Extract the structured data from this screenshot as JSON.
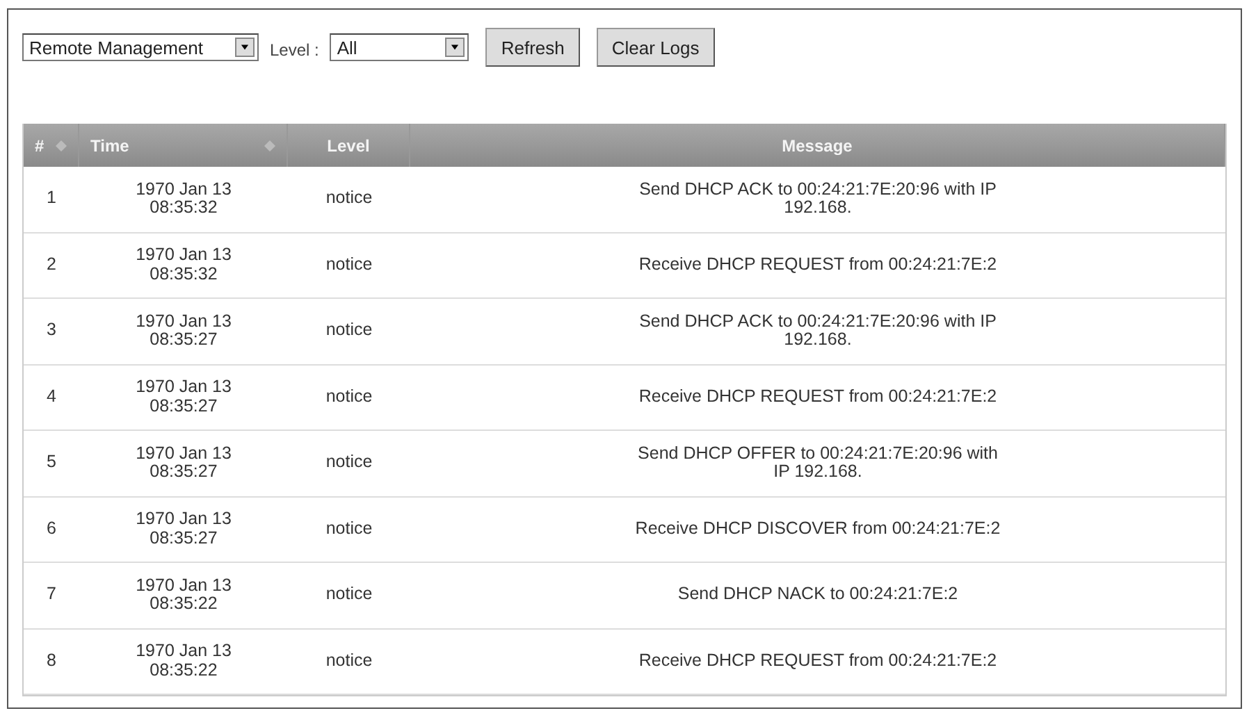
{
  "toolbar": {
    "category": {
      "value": "Remote Management"
    },
    "level_label": "Level :",
    "level": {
      "value": "All"
    },
    "buttons": [
      "Refresh",
      "Clear Logs"
    ]
  },
  "table": {
    "columns": [
      {
        "label": "#",
        "sortable": true
      },
      {
        "label": "Time",
        "sortable": true
      },
      {
        "label": "Level",
        "sortable": false
      },
      {
        "label": "Message",
        "sortable": false
      }
    ],
    "rows": [
      {
        "index": "1",
        "date": "1970 Jan 13",
        "time": "08:35:32",
        "level": "notice",
        "message": "Send DHCP ACK to 00:24:21:7E:20:96 with IP 192.168."
      },
      {
        "index": "2",
        "date": "1970 Jan 13",
        "time": "08:35:32",
        "level": "notice",
        "message": "Receive DHCP REQUEST from 00:24:21:7E:2"
      },
      {
        "index": "3",
        "date": "1970 Jan 13",
        "time": "08:35:27",
        "level": "notice",
        "message": "Send DHCP ACK to 00:24:21:7E:20:96 with IP 192.168."
      },
      {
        "index": "4",
        "date": "1970 Jan 13",
        "time": "08:35:27",
        "level": "notice",
        "message": "Receive DHCP REQUEST from 00:24:21:7E:2"
      },
      {
        "index": "5",
        "date": "1970 Jan 13",
        "time": "08:35:27",
        "level": "notice",
        "message": "Send DHCP OFFER to 00:24:21:7E:20:96 with IP 192.168."
      },
      {
        "index": "6",
        "date": "1970 Jan 13",
        "time": "08:35:27",
        "level": "notice",
        "message": "Receive DHCP DISCOVER from 00:24:21:7E:2"
      },
      {
        "index": "7",
        "date": "1970 Jan 13",
        "time": "08:35:22",
        "level": "notice",
        "message": "Send DHCP NACK to 00:24:21:7E:2"
      },
      {
        "index": "8",
        "date": "1970 Jan 13",
        "time": "08:35:22",
        "level": "notice",
        "message": "Receive DHCP REQUEST from 00:24:21:7E:2"
      }
    ]
  }
}
